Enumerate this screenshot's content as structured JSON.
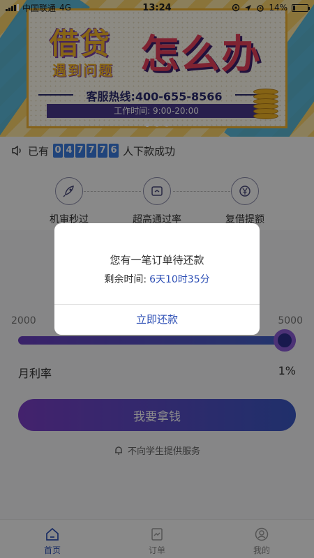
{
  "status_bar": {
    "carrier": "中国联通",
    "network": "4G",
    "time": "13:24",
    "battery": "14%",
    "battery_level": 0.14
  },
  "banner": {
    "title_left": "借贷",
    "subtitle_left": "遇到问题",
    "title_right": "怎么办",
    "hotline": "客服热线:400-655-8566",
    "hours": "工作时间: 9:00-20:00"
  },
  "notice": {
    "prefix": "已有",
    "digits": [
      "0",
      "4",
      "7",
      "7",
      "7",
      "6"
    ],
    "suffix": "人下款成功"
  },
  "features": [
    {
      "label": "机审秒过",
      "icon": "rocket-icon"
    },
    {
      "label": "超高通过率",
      "icon": "ticket-icon"
    },
    {
      "label": "复借提额",
      "icon": "yen-icon"
    }
  ],
  "slider": {
    "min": "2000",
    "max": "5000",
    "value_fraction": 0.96
  },
  "rate": {
    "label": "月利率",
    "value": "1%"
  },
  "cta": {
    "label": "我要拿钱"
  },
  "note": "不向学生提供服务",
  "tabs": [
    {
      "label": "首页",
      "icon": "home-icon",
      "active": true
    },
    {
      "label": "订单",
      "icon": "order-icon",
      "active": false
    },
    {
      "label": "我的",
      "icon": "profile-icon",
      "active": false
    }
  ],
  "modal": {
    "title": "您有一笔订单待还款",
    "remaining_label": "剩余时间:",
    "remaining_value": "6天10时35分",
    "action": "立即还款"
  },
  "colors": {
    "accent": "#2d4fb5",
    "gradient_start": "#7b3fc7",
    "gradient_end": "#3a58c4"
  }
}
